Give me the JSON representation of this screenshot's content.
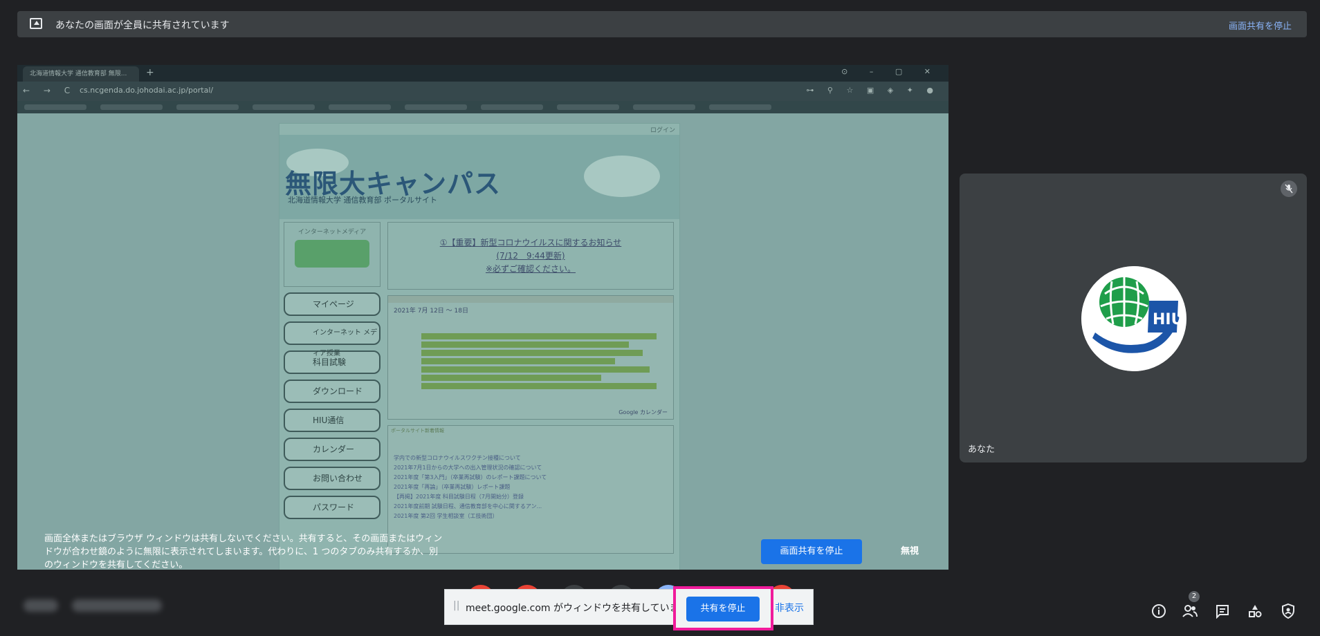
{
  "notice_bar": {
    "message": "あなたの画面が全員に共有されています",
    "stop_link": "画面共有を停止"
  },
  "shared_screen": {
    "browser": {
      "tab_title": "北海道情報大学 通信教育部 無限...",
      "url": "cs.ncgenda.do.johodai.ac.jp/portal/",
      "login_label": "ログイン"
    },
    "portal": {
      "logo": "無限大キャンパス",
      "sublogo": "北海道情報大学 通信教育部 ポータルサイト",
      "media_box": "インターネットメディア",
      "menu": [
        "マイページ",
        "インターネット メディア授業",
        "科目試験",
        "ダウンロード",
        "HIU通信",
        "カレンダー",
        "お問い合わせ",
        "パスワード"
      ],
      "notice_lines": [
        "①【重要】新型コロナウイルスに関するお知らせ",
        "(7/12　9:44更新)",
        "※必ずご確認ください。"
      ],
      "calendar_title": "2021年 7月 12日 ～ 18日",
      "calendar_footer": "Google カレンダー",
      "news_title": "ポータルサイト新着情報",
      "news_items": [
        "学内での新型コロナウイルスワクチン接種について",
        "2021年7月1日からの大学への出入管理状況の確認について",
        "2021年度「第3入門」（卒業再試験）のレポート課題について",
        "2021年度「再論」（卒業再試験）レポート課題",
        "【再掲】2021年度 科目試験日程（7月開始分）登録",
        "2021年度前期 試験日程、通信教育部を中心に関するアン...",
        "2021年度 第2回 学生相談室（工技術団）"
      ]
    }
  },
  "warning": {
    "text": "画面全体またはブラウザ ウィンドウは共有しないでください。共有すると、その画面またはウィンドウが合わせ鏡のように無限に表示されてしまいます。代わりに、1 つのタブのみ共有するか、別のウィンドウを共有してください。",
    "stop_button": "画面共有を停止",
    "ignore_button": "無視"
  },
  "self_tile": {
    "name": "あなた",
    "avatar": "hiu-logo",
    "avatar_letters": "HIU",
    "mic": "mic-off-icon"
  },
  "share_bar": {
    "message": "meet.google.com がウィンドウを共有しています。",
    "stop_button": "共有を停止",
    "hide_link": "非表示"
  },
  "bottom_right": {
    "participant_count": "2",
    "icons": [
      "info-icon",
      "people-icon",
      "chat-icon",
      "activities-icon",
      "host-controls-icon"
    ]
  },
  "colors": {
    "background": "#202124",
    "accent_blue": "#1a73e8",
    "link_blue": "#8ab4f8",
    "highlight_pink": "#f01b9b"
  }
}
